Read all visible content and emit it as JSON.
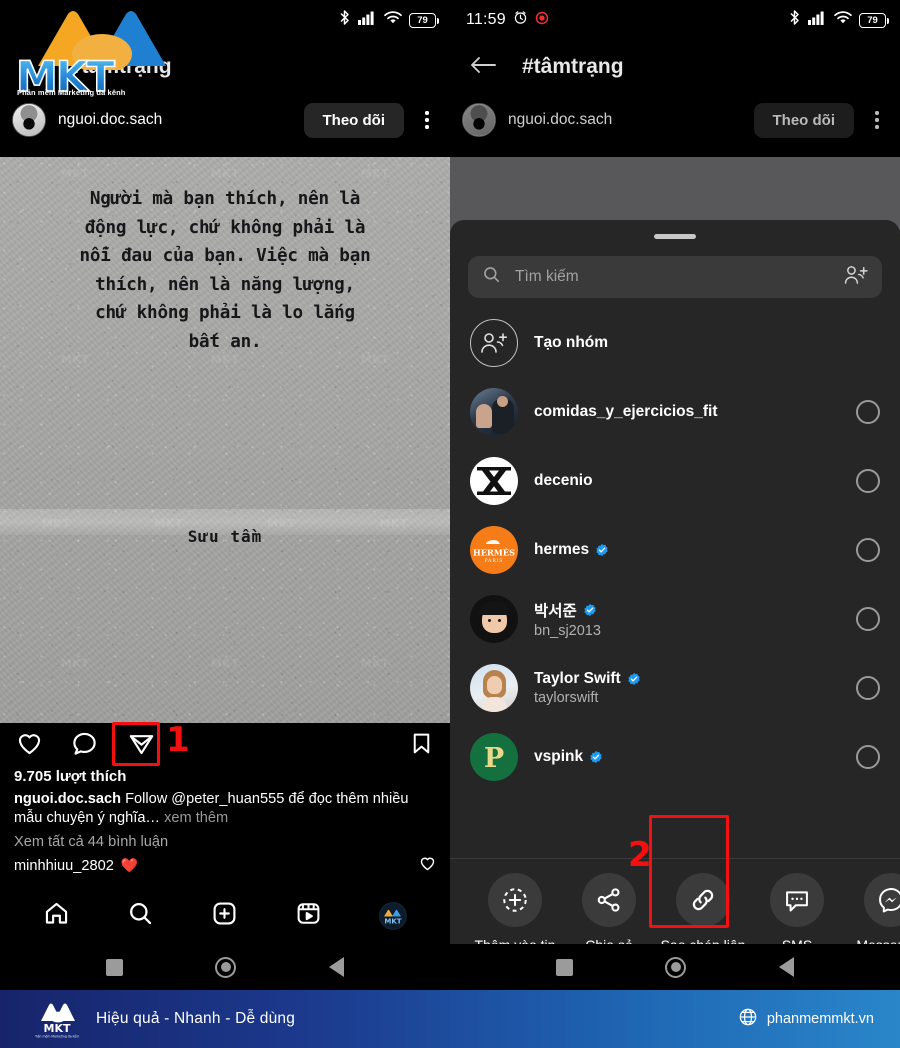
{
  "left": {
    "status": {
      "bluetooth": "bluetooth-icon",
      "signal": "signal-icon",
      "wifi": "wifi-icon",
      "battery": "79"
    },
    "logo": {
      "word": "MKT",
      "sub": "Phần mềm Marketing đa kênh"
    },
    "hashtag_title": "#tâmtrạng",
    "post_header": {
      "username": "nguoi.doc.sach",
      "follow_label": "Theo dõi",
      "menu": "kebab-menu-icon"
    },
    "photo": {
      "quote_lines": [
        "Người mà bạn thích, nên là",
        "động lực, chứ không phải là",
        "nỗi đau của bạn. Việc mà bạn",
        "thích, nên là năng lượng,",
        "chứ không phải là lo lắng",
        "bất an."
      ],
      "credit": "Sưu tầm",
      "watermark": "MKT"
    },
    "actions": {
      "like": "heart-icon",
      "comment": "comment-icon",
      "share": "share-paperplane-icon",
      "save": "bookmark-icon"
    },
    "likes": "9.705 lượt thích",
    "caption_user": "nguoi.doc.sach",
    "caption_text": " Follow @peter_huan555 để đọc thêm nhiều mẫu chuyện ý nghĩa…",
    "caption_more": " xem thêm",
    "view_comments": "Xem tất cả 44 bình luận",
    "comment_user": "minhhiuu_2802",
    "comment_heart": "❤️",
    "tabs": [
      {
        "name": "home-tab",
        "icon": "home-icon"
      },
      {
        "name": "search-tab",
        "icon": "search-icon"
      },
      {
        "name": "create-tab",
        "icon": "plus-square-icon"
      },
      {
        "name": "reels-tab",
        "icon": "reels-icon"
      },
      {
        "name": "profile-tab",
        "icon": "profile-avatar-icon"
      }
    ],
    "sysnav": [
      "recents-square",
      "home-circle",
      "back-triangle"
    ]
  },
  "right": {
    "status": {
      "time": "11:59",
      "alarm": "alarm-icon",
      "record": "record-icon",
      "battery": "79"
    },
    "topbar": {
      "back": "back-arrow-icon",
      "title": "#tâmtrạng"
    },
    "post_header": {
      "username": "nguoi.doc.sach",
      "follow_label": "Theo dõi",
      "menu": "kebab-menu-icon"
    },
    "sheet": {
      "search_placeholder": "Tìm kiếm",
      "add_people_icon": "add-people-icon",
      "new_group_label": "Tạo nhóm",
      "contacts": [
        {
          "title": "comidas_y_ejercicios_fit",
          "sub": "",
          "verified": false,
          "avatar": "photo-couple-gym"
        },
        {
          "title": "decenio",
          "sub": "",
          "verified": false,
          "avatar": "letter-X-white"
        },
        {
          "title": "hermes",
          "sub": "",
          "verified": true,
          "avatar": "hermes-orange-logo"
        },
        {
          "title": "박서준",
          "sub": "bn_sj2013",
          "verified": true,
          "avatar": "memoji-dark"
        },
        {
          "title": "Taylor Swift",
          "sub": "taylorswift",
          "verified": true,
          "avatar": "photo-portrait"
        },
        {
          "title": "vspink",
          "sub": "",
          "verified": true,
          "avatar": "letter-P-green"
        }
      ],
      "share_actions": [
        {
          "label": "Thêm vào tin",
          "icon": "add-to-story-icon"
        },
        {
          "label": "Chia sẻ",
          "icon": "share-nodes-icon"
        },
        {
          "label": "Sao chép liên kết",
          "icon": "link-icon"
        },
        {
          "label": "SMS",
          "icon": "sms-bubble-icon"
        },
        {
          "label": "Messenger",
          "icon": "messenger-icon"
        }
      ]
    },
    "sysnav": [
      "recents-square",
      "home-circle",
      "back-triangle"
    ]
  },
  "annotations": {
    "step1": "1",
    "step2": "2",
    "color": "#f41010"
  },
  "brandbar": {
    "logo_text": "MKT",
    "logo_sub": "Phần mềm Marketing đa kênh",
    "slogan": "Hiệu quả - Nhanh - Dễ dùng",
    "globe_icon": "globe-icon",
    "url": "phanmemmkt.vn"
  }
}
